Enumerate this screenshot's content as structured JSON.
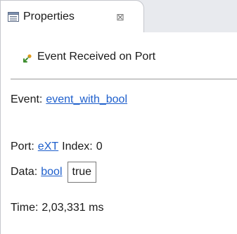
{
  "tab": {
    "title": "Properties",
    "icon": "properties-view-icon",
    "close_glyph": "⊠"
  },
  "header": {
    "icon": "event-received-icon",
    "title": "Event Received on Port"
  },
  "properties": {
    "event_label": "Event:",
    "event_value": "event_with_bool",
    "port_label": "Port:",
    "port_value": "eXT",
    "index_label": "Index:",
    "index_value": "0",
    "data_label": "Data:",
    "data_type": "bool",
    "data_value": "true",
    "time_label": "Time:",
    "time_value": "2,03,331 ms"
  },
  "colors": {
    "link": "#1e5fcc",
    "tab_strip": "#e8eaee",
    "border": "#c5c7cc"
  }
}
